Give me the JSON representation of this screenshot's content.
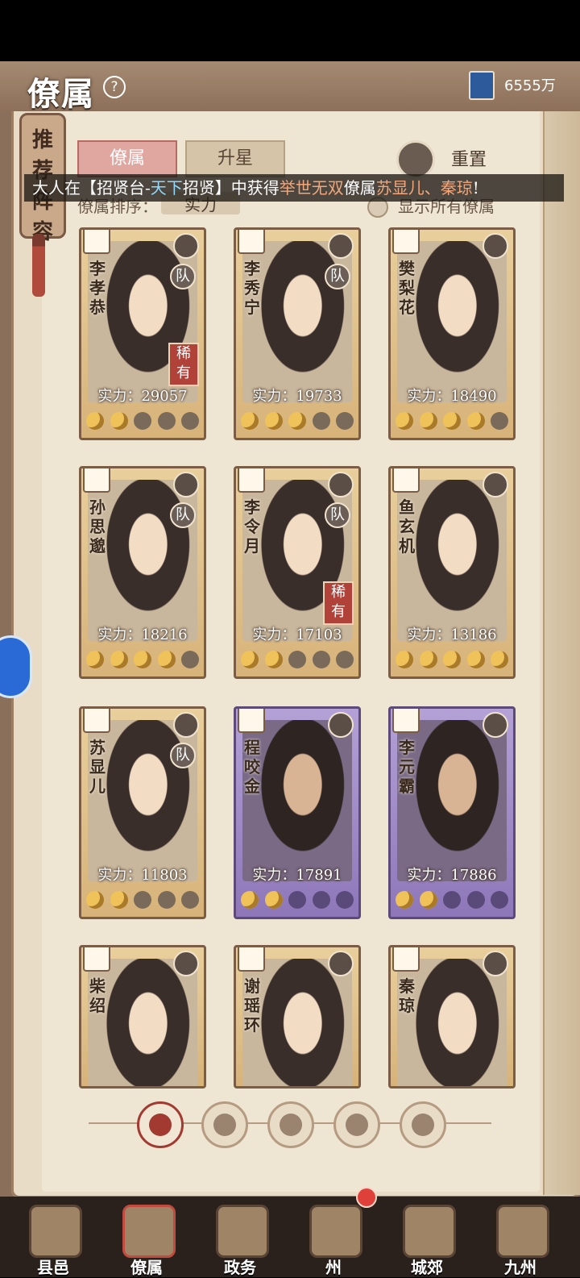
{
  "header": {
    "title": "僚属",
    "help": "?",
    "currency": "6555万"
  },
  "recommend": {
    "label": "推荐阵容"
  },
  "tabs": [
    {
      "label": "僚属"
    },
    {
      "label": "升星"
    }
  ],
  "reset_label": "重置",
  "sort": {
    "label": "僚属排序：",
    "value": "实力"
  },
  "show_all_label": "显示所有僚属",
  "banner": {
    "prefix": "大人在【招贤台-",
    "event": "天下",
    "middle": "招贤】中获得",
    "rarity": "举世无双",
    "middle2": "僚属",
    "names": "苏显儿、秦琼",
    "suffix": "!"
  },
  "cards": [
    {
      "name": "李孝恭",
      "team": "队",
      "rare": "稀有",
      "power": "实力：29057",
      "stars": 2,
      "rarity": "gold"
    },
    {
      "name": "李秀宁",
      "team": "队",
      "rare": "",
      "power": "实力：19733",
      "stars": 3,
      "rarity": "gold"
    },
    {
      "name": "樊梨花",
      "team": "",
      "rare": "",
      "power": "实力：18490",
      "stars": 4,
      "rarity": "gold"
    },
    {
      "name": "孙思邈",
      "team": "队",
      "rare": "",
      "power": "实力：18216",
      "stars": 4,
      "rarity": "gold"
    },
    {
      "name": "李令月",
      "team": "队",
      "rare": "稀有",
      "power": "实力：17103",
      "stars": 2,
      "rarity": "gold"
    },
    {
      "name": "鱼玄机",
      "team": "",
      "rare": "",
      "power": "实力：13186",
      "stars": 5,
      "rarity": "gold"
    },
    {
      "name": "苏显儿",
      "team": "队",
      "rare": "",
      "power": "实力：11803",
      "stars": 2,
      "rarity": "gold"
    },
    {
      "name": "程咬金",
      "team": "",
      "rare": "",
      "power": "实力：17891",
      "stars": 2,
      "rarity": "purple"
    },
    {
      "name": "李元霸",
      "team": "",
      "rare": "",
      "power": "实力：17886",
      "stars": 2,
      "rarity": "purple"
    },
    {
      "name": "柴绍",
      "team": "",
      "rare": "",
      "power": "",
      "stars": 0,
      "rarity": "gold"
    },
    {
      "name": "谢瑶环",
      "team": "",
      "rare": "",
      "power": "",
      "stars": 0,
      "rarity": "gold"
    },
    {
      "name": "秦琼",
      "team": "",
      "rare": "",
      "power": "",
      "stars": 0,
      "rarity": "gold"
    }
  ],
  "nav": [
    {
      "label": "县邑",
      "icon": "county-icon"
    },
    {
      "label": "僚属",
      "icon": "retinue-icon"
    },
    {
      "label": "政务",
      "icon": "affairs-icon"
    },
    {
      "label": "州",
      "icon": "prefecture-icon"
    },
    {
      "label": "城郊",
      "icon": "suburb-icon"
    },
    {
      "label": "九州",
      "icon": "nine-states-icon"
    }
  ]
}
